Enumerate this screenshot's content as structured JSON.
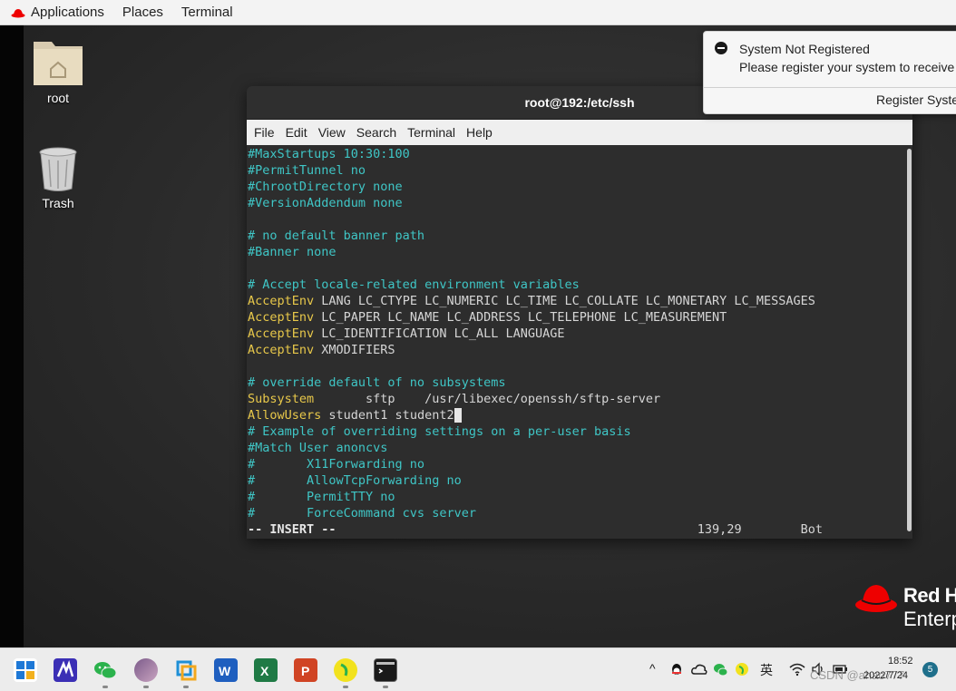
{
  "topbar": {
    "applications": "Applications",
    "places": "Places",
    "terminal": "Terminal"
  },
  "desktop": {
    "icons": [
      {
        "label": "root"
      },
      {
        "label": "Trash"
      }
    ]
  },
  "terminal_window": {
    "title": "root@192:/etc/ssh",
    "menu": [
      "File",
      "Edit",
      "View",
      "Search",
      "Terminal",
      "Help"
    ],
    "lines": [
      [
        {
          "t": "#MaxStartups 10:30:100",
          "c": "c"
        }
      ],
      [
        {
          "t": "#PermitTunnel no",
          "c": "c"
        }
      ],
      [
        {
          "t": "#ChrootDirectory none",
          "c": "c"
        }
      ],
      [
        {
          "t": "#VersionAddendum none",
          "c": "c"
        }
      ],
      [],
      [
        {
          "t": "# no default banner path",
          "c": "c"
        }
      ],
      [
        {
          "t": "#Banner none",
          "c": "c"
        }
      ],
      [],
      [
        {
          "t": "# Accept locale-related environment variables",
          "c": "c"
        }
      ],
      [
        {
          "t": "AcceptEnv",
          "c": "k"
        },
        {
          "t": " LANG LC_CTYPE LC_NUMERIC LC_TIME LC_COLLATE LC_MONETARY LC_MESSAGES",
          "c": "w"
        }
      ],
      [
        {
          "t": "AcceptEnv",
          "c": "k"
        },
        {
          "t": " LC_PAPER LC_NAME LC_ADDRESS LC_TELEPHONE LC_MEASUREMENT",
          "c": "w"
        }
      ],
      [
        {
          "t": "AcceptEnv",
          "c": "k"
        },
        {
          "t": " LC_IDENTIFICATION LC_ALL LANGUAGE",
          "c": "w"
        }
      ],
      [
        {
          "t": "AcceptEnv",
          "c": "k"
        },
        {
          "t": " XMODIFIERS",
          "c": "w"
        }
      ],
      [],
      [
        {
          "t": "# override default of no subsystems",
          "c": "c"
        }
      ],
      [
        {
          "t": "Subsystem",
          "c": "k"
        },
        {
          "t": "       sftp    /usr/libexec/openssh/sftp-server",
          "c": "w"
        }
      ],
      [
        {
          "t": "AllowUsers",
          "c": "k"
        },
        {
          "t": " student1 student2",
          "c": "w"
        },
        {
          "t": " ",
          "c": "cur"
        }
      ],
      [
        {
          "t": "# Example of overriding settings on a per-user basis",
          "c": "c"
        }
      ],
      [
        {
          "t": "#Match User anoncvs",
          "c": "c"
        }
      ],
      [
        {
          "t": "#       X11Forwarding no",
          "c": "c"
        }
      ],
      [
        {
          "t": "#       AllowTcpForwarding no",
          "c": "c"
        }
      ],
      [
        {
          "t": "#       PermitTTY no",
          "c": "c"
        }
      ],
      [
        {
          "t": "#       ForceCommand cvs server",
          "c": "c"
        }
      ],
      [
        {
          "t": "-- INSERT --",
          "c": "bold"
        },
        {
          "t": "                                                 139,29        Bot",
          "c": "w"
        }
      ]
    ]
  },
  "notification": {
    "title": "System Not Registered",
    "body": "Please register your system to receive",
    "button": "Register System"
  },
  "branding": {
    "line1": "Red Hat",
    "line2": "Enterprise"
  },
  "taskbar": {
    "tray": {
      "chevron": "^",
      "ime": "英",
      "time": "18:52",
      "date": "2022/7/24",
      "notification_count": "5",
      "watermark": "CSDN @ahao777"
    }
  },
  "colors": {
    "comment": "#3fc6c6",
    "keyword": "#e8c84a",
    "terminal_bg": "#2d2d2d",
    "accent_red": "#ee0000"
  }
}
